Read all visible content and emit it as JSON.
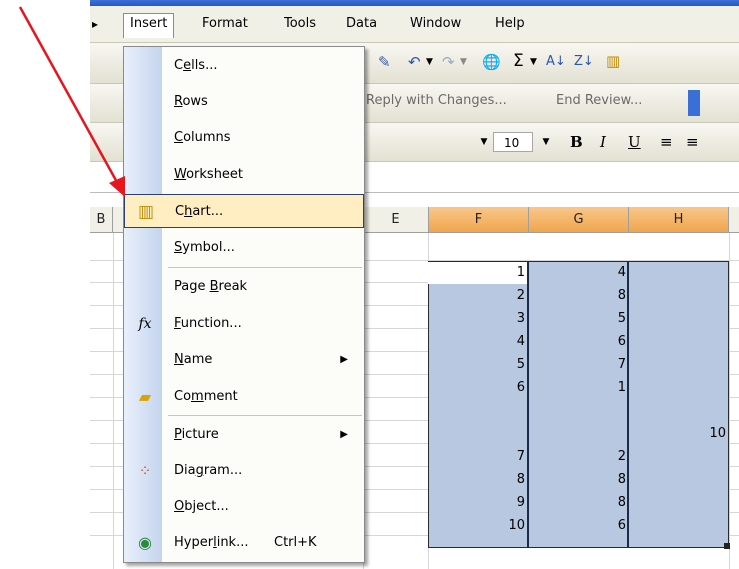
{
  "menubar": {
    "items": [
      "Insert",
      "Format",
      "Tools",
      "Data",
      "Window",
      "Help"
    ]
  },
  "toolbar": {
    "reply_with_changes": "Reply with Changes...",
    "end_review": "End Review...",
    "font_size": "10",
    "sigma": "Σ"
  },
  "column_headers": [
    "B",
    "E",
    "F",
    "G",
    "H"
  ],
  "insert_menu": {
    "items": [
      {
        "label": "Cells...",
        "mnemonic_index": 1
      },
      {
        "label": "Rows",
        "mnemonic_index": 0
      },
      {
        "label": "Columns",
        "mnemonic_index": 0
      },
      {
        "label": "Worksheet",
        "mnemonic_index": 0
      },
      {
        "label": "Chart...",
        "mnemonic_index": 1,
        "highlighted": true
      },
      {
        "label": "Symbol...",
        "mnemonic_index": 0
      },
      {
        "label": "Page Break",
        "mnemonic_index": 5
      },
      {
        "label": "Function...",
        "mnemonic_index": 0
      },
      {
        "label": "Name",
        "mnemonic_index": 0,
        "submenu": true
      },
      {
        "label": "Comment",
        "mnemonic_index": 2
      },
      {
        "label": "Picture",
        "mnemonic_index": 0,
        "submenu": true
      },
      {
        "label": "Diagram...",
        "mnemonic_index": 3
      },
      {
        "label": "Object...",
        "mnemonic_index": 0
      },
      {
        "label": "Hyperlink...",
        "mnemonic_index": 5,
        "shortcut": "Ctrl+K"
      }
    ]
  },
  "spreadsheet": {
    "rows": [
      {
        "F": "1",
        "G": "4",
        "H": ""
      },
      {
        "F": "2",
        "G": "8",
        "H": ""
      },
      {
        "F": "3",
        "G": "5",
        "H": ""
      },
      {
        "F": "4",
        "G": "6",
        "H": ""
      },
      {
        "F": "5",
        "G": "7",
        "H": ""
      },
      {
        "F": "6",
        "G": "1",
        "H": ""
      },
      {
        "F": "",
        "G": "",
        "H": "10"
      },
      {
        "F": "7",
        "G": "2",
        "H": ""
      },
      {
        "F": "8",
        "G": "8",
        "H": ""
      },
      {
        "F": "9",
        "G": "8",
        "H": ""
      },
      {
        "F": "10",
        "G": "6",
        "H": ""
      }
    ]
  },
  "annotation": {
    "color": "#e8141e"
  },
  "colors": {
    "selection": "#b7c8e0",
    "menu_highlight": "#ffeec2",
    "column_selected": "#f0a64c"
  }
}
